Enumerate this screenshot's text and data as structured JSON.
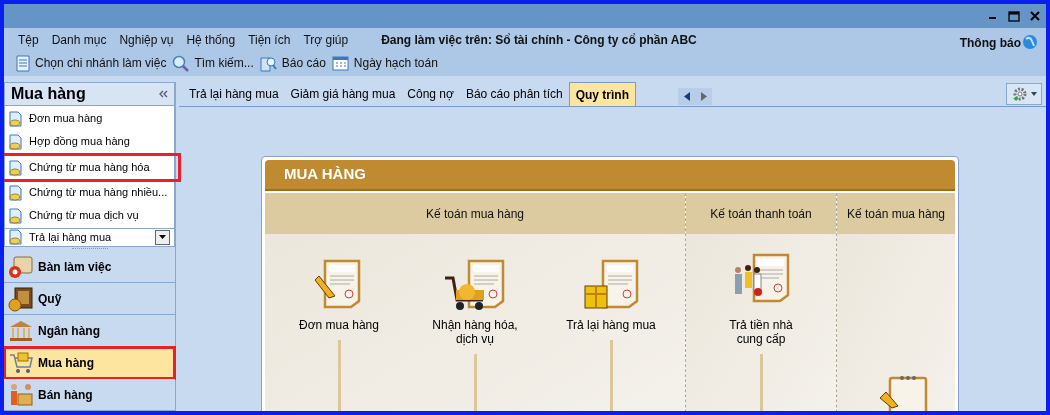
{
  "menu": [
    "Tệp",
    "Danh mục",
    "Nghiệp vụ",
    "Hệ thống",
    "Tiện ích",
    "Trợ giúp"
  ],
  "working_on": "Đang làm việc trên: Sổ tài chính - Công ty cổ phần ABC",
  "notification": "Thông báo",
  "toolbar": [
    "Chọn chi nhánh làm việc",
    "Tìm kiếm...",
    "Báo cáo",
    "Ngày hạch toán"
  ],
  "sidebar": {
    "title": "Mua hàng",
    "items": [
      {
        "label": "Đơn mua hàng",
        "highlighted": false
      },
      {
        "label": "Hợp đồng mua hàng",
        "highlighted": false
      },
      {
        "label": "Chứng từ mua hàng hóa",
        "highlighted": true
      },
      {
        "label": "Chứng từ mua  hàng nhiều...",
        "highlighted": false
      },
      {
        "label": "Chứng từ mua dịch vụ",
        "highlighted": false
      }
    ],
    "dropdown_item": "Trả lại hàng mua",
    "nav": [
      {
        "label": "Bàn làm việc",
        "kind": "desk",
        "selected": false,
        "highlighted": false
      },
      {
        "label": "Quỹ",
        "kind": "safe",
        "selected": false,
        "highlighted": false
      },
      {
        "label": "Ngân hàng",
        "kind": "bank",
        "selected": false,
        "highlighted": false
      },
      {
        "label": "Mua hàng",
        "kind": "cart",
        "selected": true,
        "highlighted": true
      },
      {
        "label": "Bán hàng",
        "kind": "sale",
        "selected": false,
        "highlighted": false
      }
    ]
  },
  "tabs": [
    {
      "label": "Trả lại hàng mua",
      "selected": false
    },
    {
      "label": "Giảm giá hàng mua",
      "selected": false
    },
    {
      "label": "Công nợ",
      "selected": false
    },
    {
      "label": "Báo cáo phân tích",
      "selected": false
    },
    {
      "label": "Quy trình",
      "selected": true
    }
  ],
  "process": {
    "title": "MUA HÀNG",
    "lanes": [
      {
        "title": "Kế toán mua hàng",
        "steps": [
          {
            "kind": "order",
            "label": "Đơn mua hàng"
          },
          {
            "kind": "receive",
            "label": "Nhận hàng hóa,\ndịch vụ"
          },
          {
            "kind": "return",
            "label": "Trả lại hàng mua"
          }
        ]
      },
      {
        "title": "Kế toán thanh toán",
        "steps": [
          {
            "kind": "pay",
            "label": "Trả tiền nhà\ncung cấp"
          }
        ]
      },
      {
        "title": "Kế toán mua hàng",
        "steps": [
          {
            "kind": "report"
          }
        ]
      }
    ]
  }
}
